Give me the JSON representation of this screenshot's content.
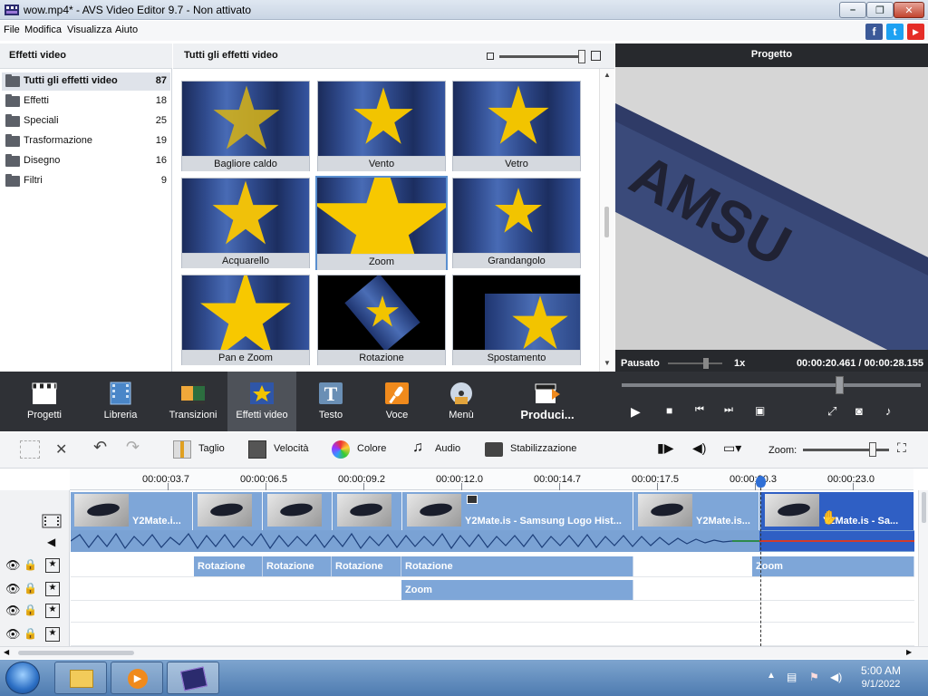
{
  "window": {
    "title": "wow.mp4* - AVS Video Editor 9.7 - Non attivato",
    "minimize_glyph": "–",
    "maximize_glyph": "❐",
    "close_glyph": "✕"
  },
  "menu": {
    "items": [
      "File",
      "Modifica",
      "Visualizza",
      "Aiuto"
    ],
    "social": [
      "f",
      "t",
      "▶"
    ]
  },
  "categories": {
    "header": "Effetti video",
    "items": [
      {
        "label": "Tutti gli effetti video",
        "count": "87",
        "selected": true
      },
      {
        "label": "Effetti",
        "count": "18"
      },
      {
        "label": "Speciali",
        "count": "25"
      },
      {
        "label": "Trasformazione",
        "count": "19"
      },
      {
        "label": "Disegno",
        "count": "16"
      },
      {
        "label": "Filtri",
        "count": "9"
      }
    ]
  },
  "effects_grid": {
    "header": "Tutti gli effetti video",
    "tiles": [
      "Bagliore caldo",
      "Vento",
      "Vetro",
      "Acquarello",
      "Zoom",
      "Grandangolo",
      "Pan e Zoom",
      "Rotazione",
      "Spostamento"
    ],
    "selected": "Zoom"
  },
  "preview": {
    "title": "Progetto",
    "status": "Pausato",
    "speed": "1x",
    "time": "00:00:20.461  /  00:00:28.155"
  },
  "tabs": [
    {
      "label": "Progetti",
      "icon": "clapper-icon"
    },
    {
      "label": "Libreria",
      "icon": "film-icon"
    },
    {
      "label": "Transizioni",
      "icon": "transition-icon"
    },
    {
      "label": "Effetti video",
      "icon": "star-effect-icon",
      "active": true
    },
    {
      "label": "Testo",
      "icon": "text-icon"
    },
    {
      "label": "Voce",
      "icon": "microphone-icon"
    },
    {
      "label": "Menù",
      "icon": "disc-icon"
    },
    {
      "label": "Produci...",
      "icon": "produce-icon"
    }
  ],
  "timeline_toolbar": {
    "taglio": "Taglio",
    "velocita": "Velocità",
    "colore": "Colore",
    "audio": "Audio",
    "stabilizzazione": "Stabilizzazione",
    "zoom": "Zoom:"
  },
  "ruler": [
    "00:00:03.7",
    "00:00:06.5",
    "00:00:09.2",
    "00:00:12.0",
    "00:00:14.7",
    "00:00:17.5",
    "00:00:20.3",
    "00:00:23.0"
  ],
  "clips": [
    {
      "label": "Y2Mate.i..."
    },
    {
      "label": ""
    },
    {
      "label": ""
    },
    {
      "label": ""
    },
    {
      "label": "Y2Mate.is - Samsung Logo Hist..."
    },
    {
      "label": "Y2Mate.is..."
    },
    {
      "label": "Y2Mate.is - Sa..."
    }
  ],
  "effects_track1": [
    "Rotazione",
    "Rotazione",
    "Rotazione",
    "Rotazione",
    "Zoom"
  ],
  "effects_track2": [
    "Zoom"
  ],
  "taskbar": {
    "time": "5:00 AM",
    "date": "9/1/2022"
  },
  "colors": {
    "accent": "#2f6fd6",
    "clip": "#7ea6d8",
    "toolbar_dark": "#2f3136"
  }
}
